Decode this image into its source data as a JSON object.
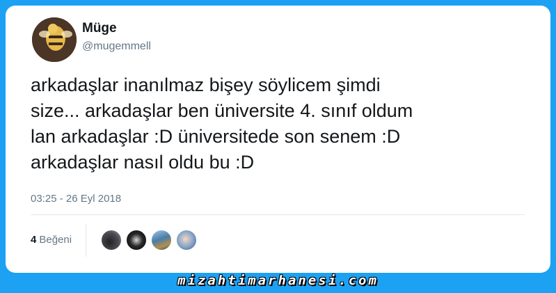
{
  "tweet": {
    "display_name": "Müge",
    "handle": "@mugemmell",
    "text": "arkadaşlar inanılmaz bişey söylicem şimdi\nsize... arkadaşlar ben üniversite 4. sınıf oldum\nlan arkadaşlar :D üniversitede son senem :D\narkadaşlar nasıl oldu bu :D",
    "timestamp": "03:25 - 26 Eyl 2018",
    "likes_count": "4",
    "likes_label": "Beğeni"
  },
  "watermark": "mizahtimarhanesi.com",
  "colors": {
    "background": "#1da1f2",
    "card": "#ffffff",
    "text_primary": "#14171a",
    "text_secondary": "#657786",
    "divider": "#e1e8ed"
  },
  "icons": {
    "avatar": "profile-avatar",
    "likers": [
      "liker-avatar",
      "liker-avatar",
      "liker-avatar",
      "liker-avatar"
    ]
  }
}
